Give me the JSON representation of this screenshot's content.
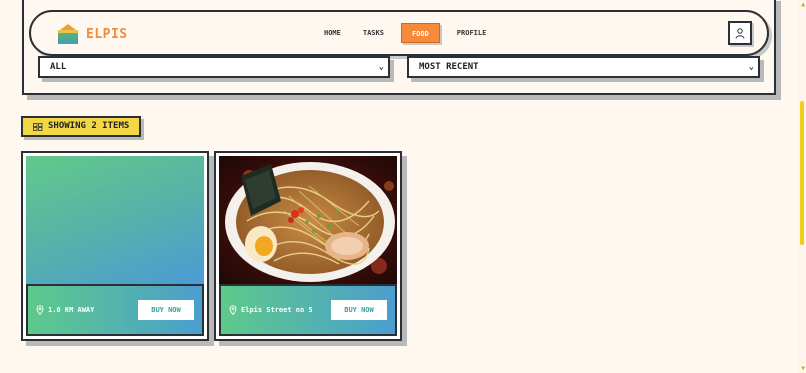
{
  "brand": {
    "name": "ELPIS"
  },
  "nav": {
    "items": [
      {
        "label": "HOME"
      },
      {
        "label": "TASKS"
      },
      {
        "label": "FOOD"
      },
      {
        "label": "PROFILE"
      }
    ],
    "active": "FOOD"
  },
  "filters": {
    "category": {
      "value": "ALL"
    },
    "sort": {
      "value": "MOST RECENT"
    }
  },
  "results": {
    "count_label": "SHOWING 2 ITEMS"
  },
  "cards": [
    {
      "location": "1.0 KM AWAY",
      "button": "BUY NOW",
      "media": "gradient-placeholder"
    },
    {
      "location": "Elpis Street no 5",
      "button": "BUY NOW",
      "media": "ramen-photo"
    }
  ],
  "colors": {
    "accent": "#f7893a",
    "badge": "#f4d744",
    "gradient_start": "#5ec98a",
    "gradient_end": "#4b9ecf",
    "border": "#2b2f36",
    "background": "#fff8f1"
  },
  "icons": {
    "profile": "user-icon",
    "location": "map-pin-icon",
    "count": "grid-icon"
  }
}
